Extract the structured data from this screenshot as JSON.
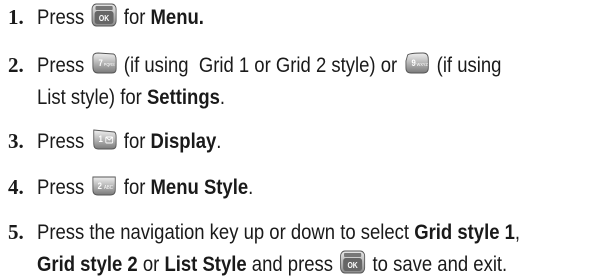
{
  "steps": [
    {
      "number": "1.",
      "t1": "Press",
      "key_icon": "menu-ok-key-icon",
      "t2": "for",
      "bold1": "Menu."
    },
    {
      "number": "2.",
      "t1": "Press",
      "key_icon": "7-pqrs-key-icon",
      "t2": "(if using  Grid 1 or Grid 2 style) or",
      "key2_icon": "9-wxyz-key-icon",
      "t3": "(if using",
      "line2": "List style) for",
      "bold1": "Settings",
      "t4": "."
    },
    {
      "number": "3.",
      "t1": "Press",
      "key_icon": "1-voicemail-key-icon",
      "t2": "for",
      "bold1": "Display",
      "t3": "."
    },
    {
      "number": "4.",
      "t1": "Press",
      "key_icon": "2-abc-key-icon",
      "t2": "for",
      "bold1": "Menu Style",
      "t3": "."
    },
    {
      "number": "5.",
      "t1": "Press the navigation key up or down to select",
      "bold1": "Grid style 1",
      "t2": ",",
      "bold2": "Grid style 2",
      "t3": "or",
      "bold3": "List Style",
      "t4": "and press",
      "key_icon": "menu-ok-key-icon",
      "t5": "to save and exit."
    }
  ],
  "key_labels": {
    "ok": "OK",
    "seven": "7",
    "seven_sub": "PQRS",
    "nine": "9",
    "nine_sub": "WXYZ",
    "one": "1",
    "two": "2",
    "two_sub": "ABC"
  }
}
